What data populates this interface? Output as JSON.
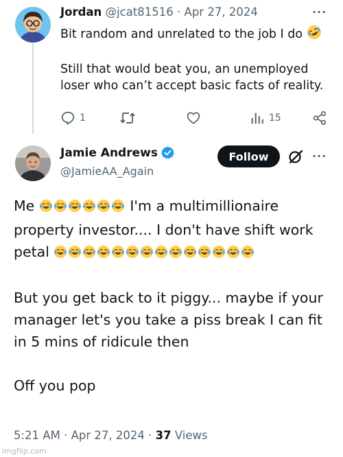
{
  "reply": {
    "name": "Jordan",
    "handle": "@jcat81516",
    "separator": "·",
    "date": "Apr 27, 2024",
    "more": "···",
    "text_line1": "Bit random and unrelated to the job I do",
    "text_line1_emoji": "rolling-on-floor-laughing",
    "text_para2": "Still that would beat you, an unemployed loser who can’t accept basic facts of reality.",
    "actions": {
      "reply_count": "1",
      "retweet_count": "",
      "like_count": "",
      "views_count": "15"
    }
  },
  "main": {
    "name": "Jamie Andrews",
    "verified": true,
    "handle": "@JamieAA_Again",
    "follow_label": "Follow",
    "more": "···",
    "para1_before": "Me",
    "para1_emoji_count_a": 6,
    "para1_after": "I'm a multimillionaire property investor.... I don't have shift work petal",
    "para1_emoji_count_b": 14,
    "emoji": "face-with-tears-of-joy",
    "para2": "But you get back to it piggy... maybe if your manager let's you take a piss break I can fit in 5 mins of ridicule then",
    "para3": "Off you pop",
    "time": "5:21 AM",
    "date": "Apr 27, 2024",
    "separator": "·",
    "views_count": "37",
    "views_label": "Views"
  },
  "watermark": "imgflip.com",
  "colors": {
    "text": "#0f1419",
    "muted": "#536471",
    "verified": "#1d9bf0",
    "follow_bg": "#0f1419",
    "thread_line": "#cfd9de"
  }
}
